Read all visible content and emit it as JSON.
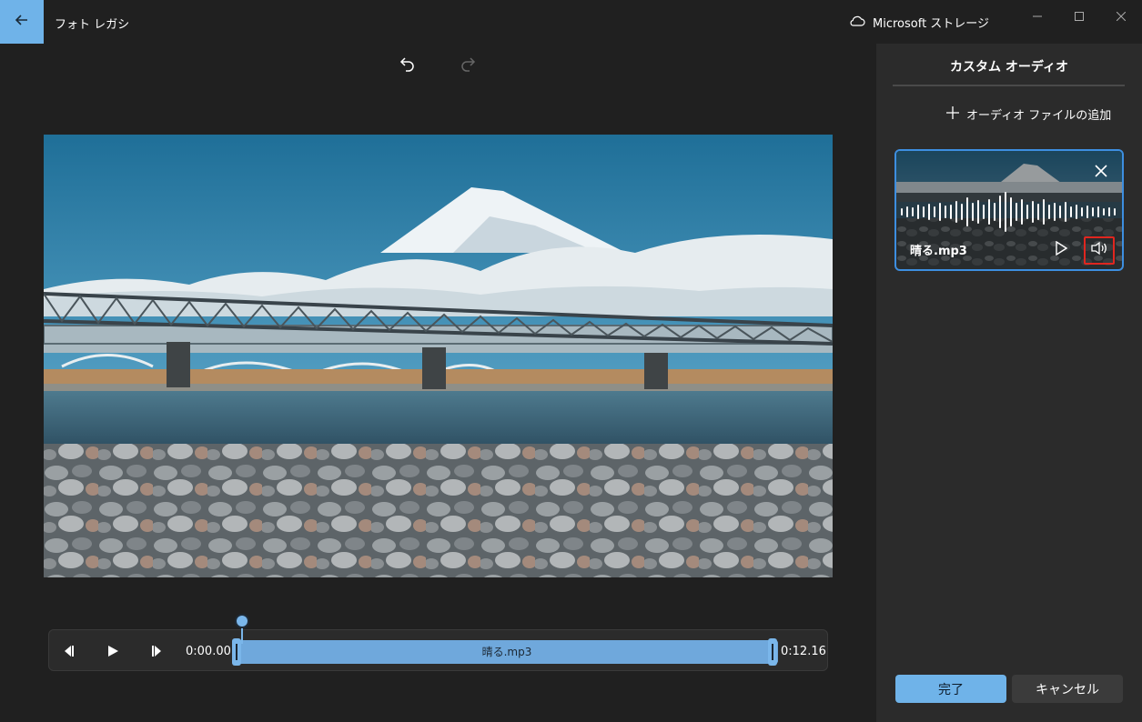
{
  "app": {
    "title": "フォト レガシ"
  },
  "titlebar": {
    "storage_label": "Microsoft ストレージ"
  },
  "icons": {
    "back": "back-arrow-icon",
    "cloud": "cloud-icon",
    "minimize": "minimize-icon",
    "maximize": "maximize-icon",
    "close": "close-icon",
    "undo": "undo-icon",
    "redo": "redo-icon",
    "add": "plus-icon",
    "play": "play-icon",
    "volume": "volume-icon",
    "remove": "close-icon",
    "step_back": "step-back-icon",
    "step_forward": "step-forward-icon"
  },
  "timeline": {
    "start_time": "0:00.00",
    "end_time": "0:12.16",
    "track_label": "晴る.mp3"
  },
  "panel": {
    "title": "カスタム オーディオ",
    "add_audio_label": "オーディオ ファイルの追加",
    "audio_card": {
      "file_name": "晴る.mp3"
    },
    "done_label": "完了",
    "cancel_label": "キャンセル"
  },
  "colors": {
    "accent": "#6fb3e9",
    "background": "#202020",
    "panel": "#2b2b2b",
    "highlight": "#e0261f",
    "card_border": "#3d8ee0"
  }
}
